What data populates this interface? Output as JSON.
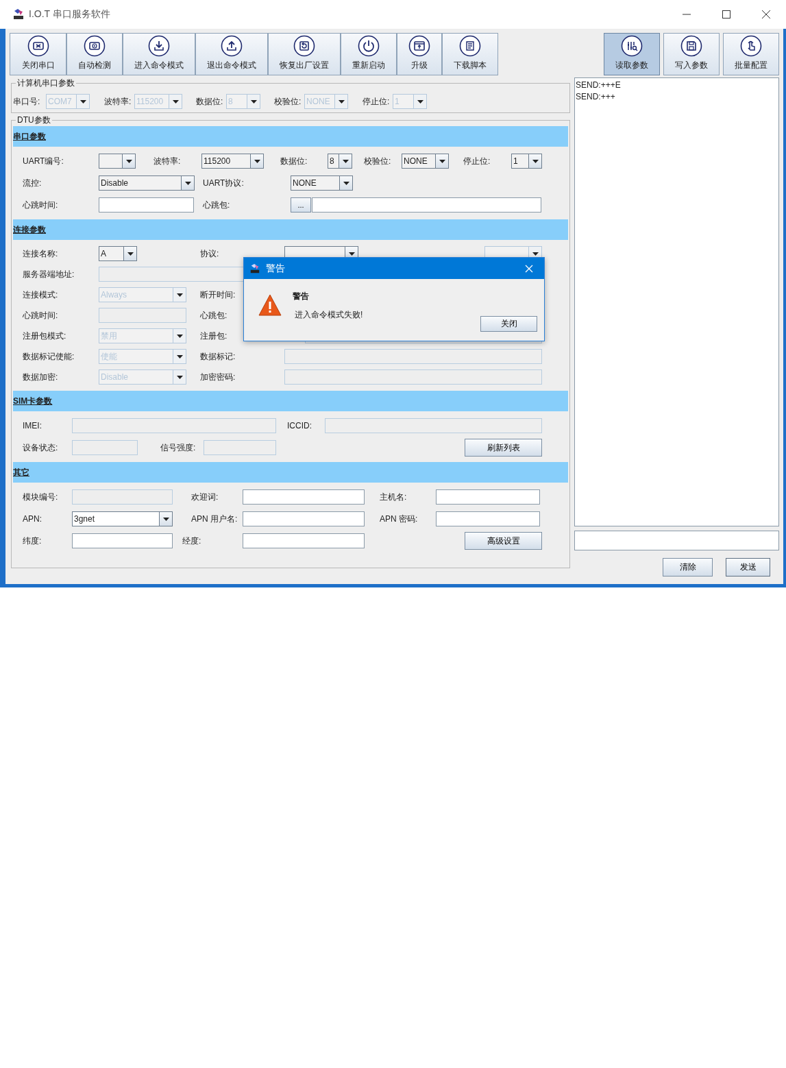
{
  "window": {
    "title": "I.O.T 串口服务软件"
  },
  "toolbar": {
    "left": [
      {
        "label": "关闭串口",
        "selected": false
      },
      {
        "label": "自动检测",
        "selected": false
      },
      {
        "label": "进入命令模式",
        "selected": false
      },
      {
        "label": "退出命令模式",
        "selected": false
      },
      {
        "label": "恢复出厂设置",
        "selected": false
      },
      {
        "label": "重新启动",
        "selected": false
      },
      {
        "label": "升级",
        "selected": false
      },
      {
        "label": "下载脚本",
        "selected": false
      }
    ],
    "right": [
      {
        "label": "读取参数",
        "selected": true
      },
      {
        "label": "写入参数",
        "selected": false
      },
      {
        "label": "批量配置",
        "selected": false
      }
    ]
  },
  "pc_serial": {
    "title": "计算机串口参数",
    "fields": [
      {
        "label": "串口号:",
        "kind": "combo",
        "value": "COM7",
        "disabled": true
      },
      {
        "label": "波特率:",
        "kind": "combo",
        "value": "115200",
        "disabled": true
      },
      {
        "label": "数据位:",
        "kind": "combo",
        "value": "8",
        "disabled": true
      },
      {
        "label": "校验位:",
        "kind": "combo",
        "value": "NONE",
        "disabled": true
      },
      {
        "label": "停止位:",
        "kind": "combo",
        "value": "1",
        "disabled": true
      }
    ]
  },
  "dtu": {
    "title": "DTU参数",
    "sections": [
      {
        "title": "串口参数",
        "rows": [
          [
            {
              "label": "UART编号:",
              "kind": "combo",
              "disabled": false
            },
            {
              "label": "波特率:",
              "kind": "combo",
              "value": "115200",
              "disabled": false
            },
            {
              "label": "数据位:",
              "kind": "combo",
              "value": "8",
              "disabled": false
            },
            {
              "label": "校验位:",
              "kind": "combo",
              "value": "NONE",
              "disabled": false
            },
            {
              "label": "停止位:",
              "kind": "combo",
              "value": "1",
              "disabled": false
            }
          ],
          [
            {
              "label": "流控:",
              "kind": "combo",
              "value": "Disable",
              "disabled": false
            },
            {
              "label": "UART协议:",
              "kind": "combo",
              "value": "NONE",
              "disabled": false
            }
          ],
          [
            {
              "label": "心跳时间:",
              "kind": "text",
              "disabled": false
            },
            {
              "label": "心跳包:",
              "kind": "browse",
              "button": "...",
              "disabled": false
            }
          ]
        ]
      },
      {
        "title": "连接参数",
        "rows": [
          [
            {
              "label": "连接名称:",
              "kind": "combo",
              "value": "A",
              "disabled": false
            },
            {
              "label": "协议:",
              "kind": "combo",
              "disabled": false
            },
            {
              "kind": "combo",
              "disabled": true
            }
          ],
          [
            {
              "label": "服务器端地址:",
              "kind": "text",
              "disabled": true
            }
          ],
          [
            {
              "label": "连接模式:",
              "kind": "combo",
              "value": "Always",
              "disabled": true
            },
            {
              "label": "断开时间:"
            }
          ],
          [
            {
              "label": "心跳时间:",
              "kind": "text",
              "disabled": true
            },
            {
              "label": "心跳包:"
            }
          ],
          [
            {
              "label": "注册包模式:",
              "kind": "combo",
              "value": "禁用",
              "disabled": true
            },
            {
              "label": "注册包:",
              "kind": "text",
              "disabled": true
            }
          ],
          [
            {
              "label": "数据标记使能:",
              "kind": "combo",
              "value": "使能",
              "disabled": true
            },
            {
              "label": "数据标记:",
              "kind": "text",
              "disabled": true
            }
          ],
          [
            {
              "label": "数据加密:",
              "kind": "combo",
              "value": "Disable",
              "disabled": true
            },
            {
              "label": "加密密码:",
              "kind": "text",
              "disabled": true
            }
          ]
        ]
      },
      {
        "title": "SIM卡参数",
        "rows": [
          [
            {
              "label": "IMEI:",
              "kind": "text",
              "disabled": true
            },
            {
              "label": "ICCID:",
              "kind": "text",
              "disabled": true
            }
          ],
          [
            {
              "label": "设备状态:",
              "kind": "text",
              "disabled": true
            },
            {
              "label": "信号强度:",
              "kind": "text",
              "disabled": true
            },
            {
              "kind": "button",
              "button": "刷新列表"
            }
          ]
        ]
      },
      {
        "title": "其它",
        "rows": [
          [
            {
              "label": "模块编号:",
              "kind": "text",
              "disabled": true
            },
            {
              "label": "欢迎词:",
              "kind": "text",
              "disabled": false
            },
            {
              "label": "主机名:",
              "kind": "text",
              "disabled": false
            }
          ],
          [
            {
              "label": "APN:",
              "kind": "combo",
              "value": "3gnet",
              "disabled": false
            },
            {
              "label": "APN 用户名:",
              "kind": "text",
              "disabled": false
            },
            {
              "label": "APN 密码:",
              "kind": "text",
              "disabled": false
            }
          ],
          [
            {
              "label": "纬度:",
              "kind": "text",
              "disabled": false
            },
            {
              "label": "经度:",
              "kind": "text",
              "disabled": false
            },
            {
              "kind": "button",
              "button": "高级设置"
            }
          ]
        ]
      }
    ]
  },
  "log": {
    "lines": [
      "SEND:+++E",
      "SEND:+++"
    ]
  },
  "buttons": [
    "清除",
    "发送"
  ],
  "dialog": {
    "title": "警告",
    "heading": "警告",
    "message": "进入命令模式失败!",
    "button": "关闭"
  }
}
